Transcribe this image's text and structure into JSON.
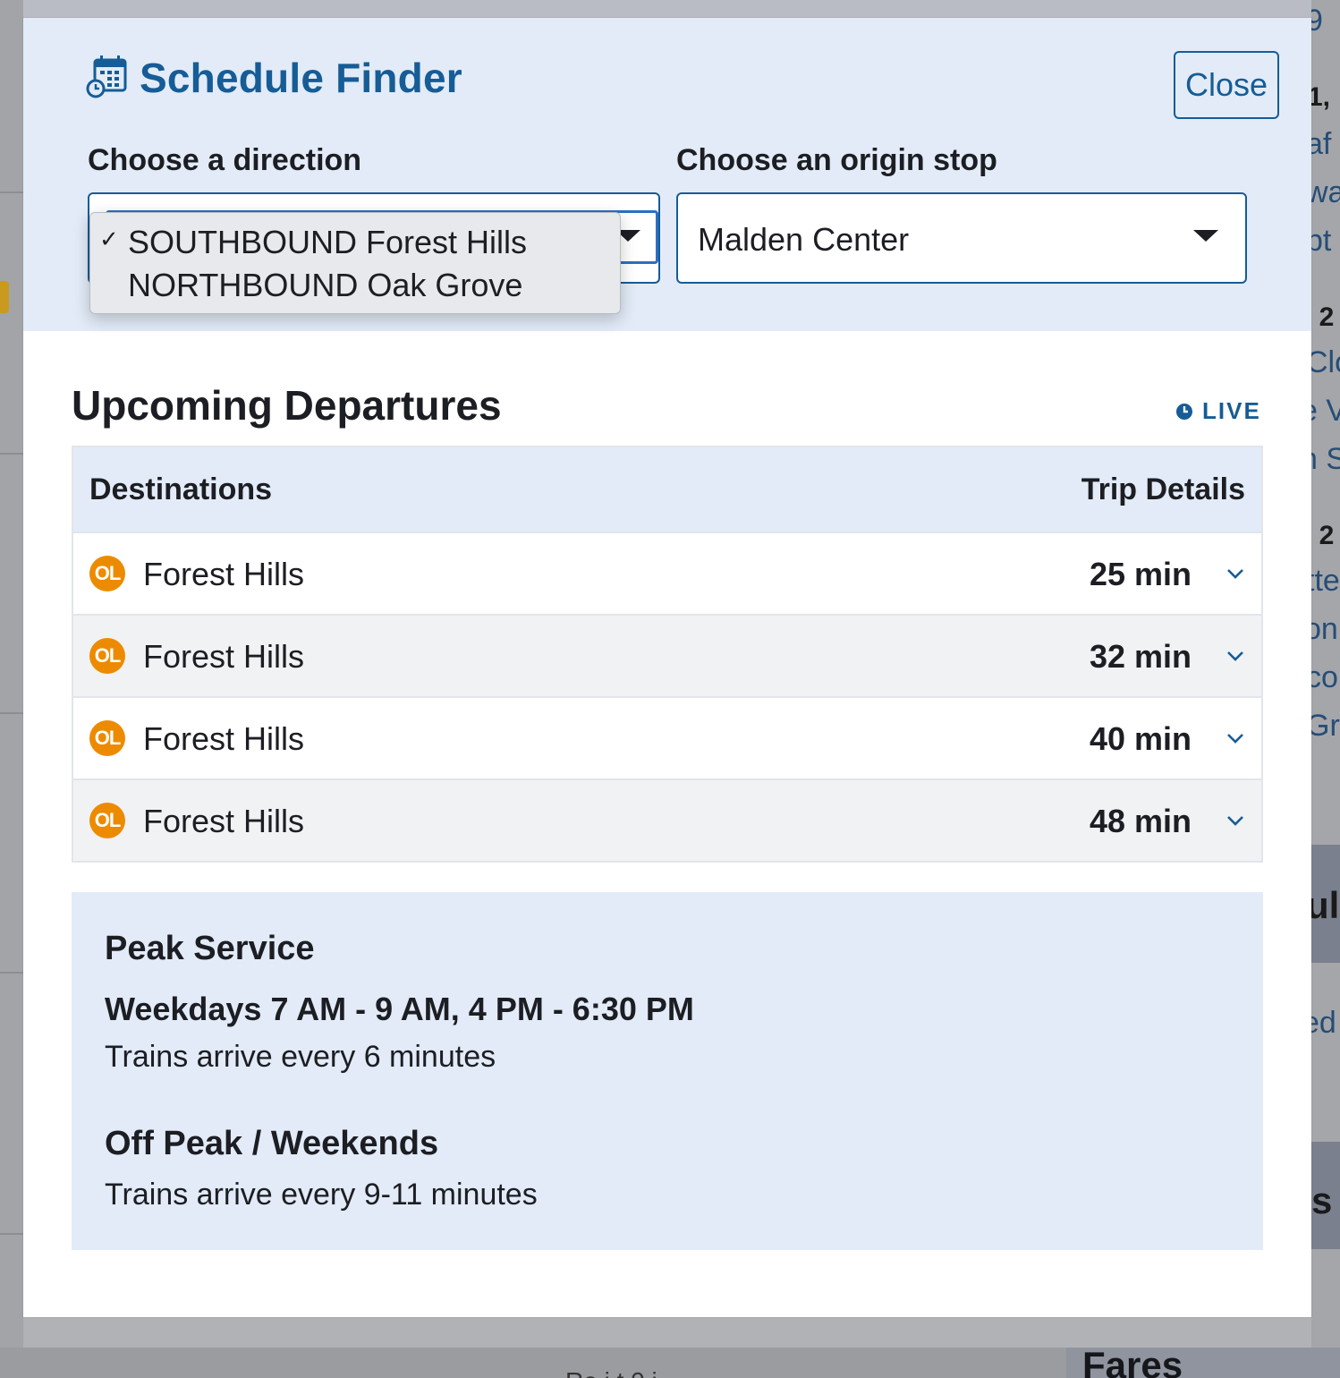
{
  "background": {
    "right_fragments": [
      "9",
      "1,",
      "af",
      "wa",
      "pt",
      ", 2",
      "Clo",
      "e V",
      "n S",
      ", 2",
      "tte",
      "on,",
      "co",
      "Gr",
      "ul",
      "ed",
      "s"
    ],
    "fares_heading": "Fares",
    "bottom_fragment": "Ro i t    0   i"
  },
  "header": {
    "title": "Schedule Finder",
    "close_label": "Close",
    "direction_label": "Choose a direction",
    "origin_label": "Choose an origin stop",
    "origin_value": "Malden Center",
    "direction_options": [
      "SOUTHBOUND Forest Hills",
      "NORTHBOUND Oak Grove"
    ],
    "direction_selected_mark": "✓"
  },
  "departures": {
    "title": "Upcoming Departures",
    "live_label": "LIVE",
    "col_destinations": "Destinations",
    "col_trip_details": "Trip Details",
    "rows": [
      {
        "badge": "OL",
        "destination": "Forest Hills",
        "minutes": "25 min"
      },
      {
        "badge": "OL",
        "destination": "Forest Hills",
        "minutes": "32 min"
      },
      {
        "badge": "OL",
        "destination": "Forest Hills",
        "minutes": "40 min"
      },
      {
        "badge": "OL",
        "destination": "Forest Hills",
        "minutes": "48 min"
      }
    ]
  },
  "service": {
    "peak_title": "Peak Service",
    "peak_hours": "Weekdays 7 AM - 9 AM, 4 PM - 6:30 PM",
    "peak_frequency": "Trains arrive every 6 minutes",
    "offpeak_title": "Off Peak / Weekends",
    "offpeak_frequency": "Trains arrive every 9-11 minutes"
  },
  "colors": {
    "brand_blue": "#165c96",
    "header_bg": "#e2ebf7",
    "orange_line": "#ed8b00"
  },
  "icons": {
    "title": "calendar-clock-icon",
    "live": "clock-icon",
    "row_toggle": "chevron-down-icon",
    "select_caret": "caret-down-icon"
  }
}
